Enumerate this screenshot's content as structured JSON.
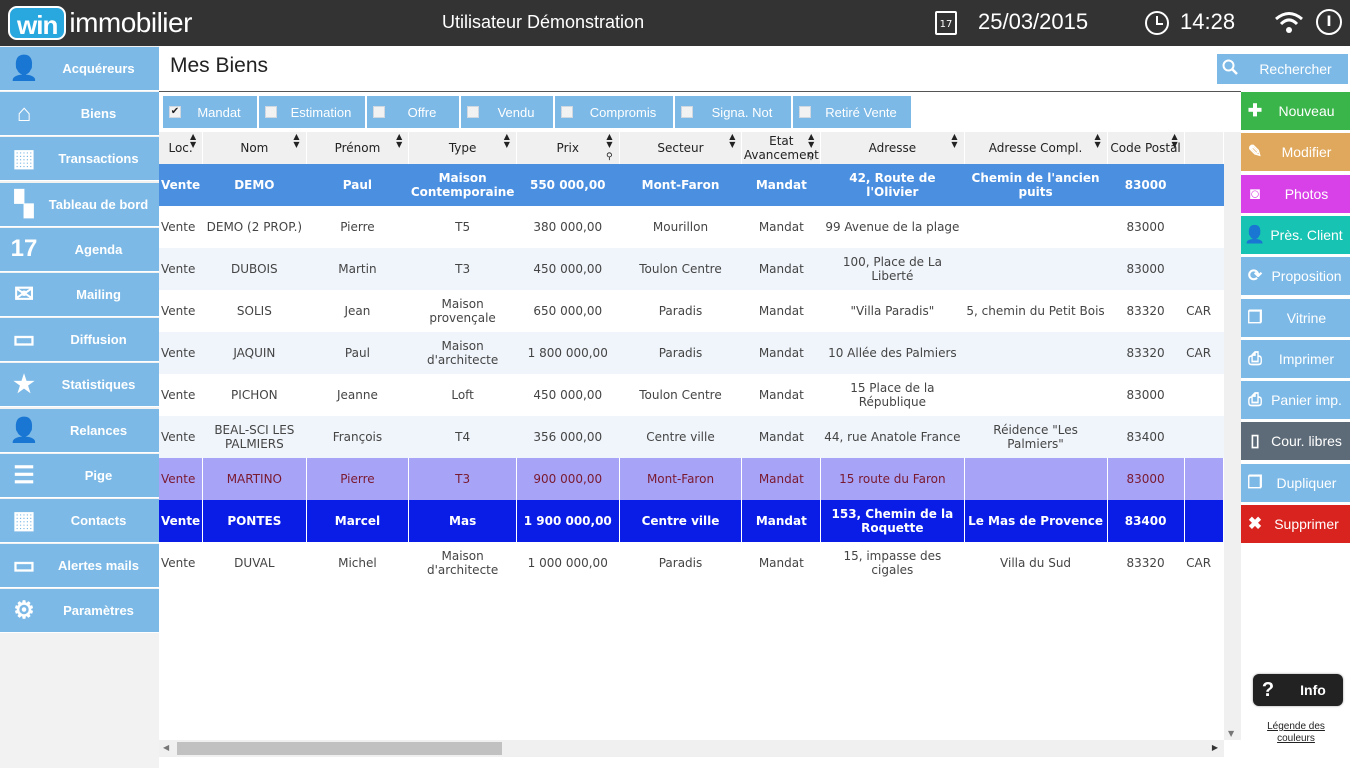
{
  "header": {
    "logo_win": "win",
    "logo_rest": "immobilier",
    "user": "Utilisateur Démonstration",
    "calendar_day": "17",
    "date": "25/03/2015",
    "time": "14:28",
    "power_glyph": "I"
  },
  "sidebar": {
    "items": [
      {
        "label": "Acquéreurs",
        "icon": "👤",
        "icon_name": "user-icon"
      },
      {
        "label": "Biens",
        "icon": "⌂",
        "icon_name": "house-icon"
      },
      {
        "label": "Transactions",
        "icon": "▦",
        "icon_name": "transactions-icon"
      },
      {
        "label": "Tableau de bord",
        "icon": "▚",
        "icon_name": "dashboard-icon"
      },
      {
        "label": "Agenda",
        "icon": "17",
        "icon_name": "calendar-icon"
      },
      {
        "label": "Mailing",
        "icon": "✉",
        "icon_name": "mail-icon"
      },
      {
        "label": "Diffusion",
        "icon": "▭",
        "icon_name": "diffusion-icon"
      },
      {
        "label": "Statistiques",
        "icon": "★",
        "icon_name": "star-icon"
      },
      {
        "label": "Relances",
        "icon": "👤",
        "icon_name": "relances-icon"
      },
      {
        "label": "Pige",
        "icon": "☰",
        "icon_name": "list-icon"
      },
      {
        "label": "Contacts",
        "icon": "▦",
        "icon_name": "contacts-icon"
      },
      {
        "label": "Alertes mails",
        "icon": "▭",
        "icon_name": "monitor-icon"
      },
      {
        "label": "Paramètres",
        "icon": "⚙",
        "icon_name": "gear-icon"
      }
    ]
  },
  "main": {
    "title": "Mes Biens",
    "search_label": "Rechercher"
  },
  "filters": [
    {
      "label": "Mandat",
      "checked": "✔"
    },
    {
      "label": "Estimation",
      "checked": ""
    },
    {
      "label": "Offre",
      "checked": ""
    },
    {
      "label": "Vendu",
      "checked": ""
    },
    {
      "label": "Compromis",
      "checked": ""
    },
    {
      "label": "Signa. Not",
      "checked": ""
    },
    {
      "label": "Retiré Vente",
      "checked": ""
    }
  ],
  "table": {
    "columns": [
      "Loc.",
      "Nom",
      "Prénom",
      "Type",
      "Prix",
      "Secteur",
      "Etat Avancement",
      "Adresse",
      "Adresse Compl.",
      "Code Postal",
      ""
    ],
    "rows": [
      [
        "Vente",
        "DEMO",
        "Paul",
        "Maison Contemporaine",
        "550 000,00",
        "Mont-Faron",
        "Mandat",
        "42, Route de l'Olivier",
        "Chemin de l'ancien puits",
        "83000",
        ""
      ],
      [
        "Vente",
        "DEMO (2 PROP.)",
        "Pierre",
        "T5",
        "380 000,00",
        "Mourillon",
        "Mandat",
        "99 Avenue de la plage",
        "",
        "83000",
        ""
      ],
      [
        "Vente",
        "DUBOIS",
        "Martin",
        "T3",
        "450 000,00",
        "Toulon Centre",
        "Mandat",
        "100, Place de La Liberté",
        "",
        "83000",
        ""
      ],
      [
        "Vente",
        "SOLIS",
        "Jean",
        "Maison provençale",
        "650 000,00",
        "Paradis",
        "Mandat",
        "\"Villa Paradis\"",
        "5, chemin du Petit Bois",
        "83320",
        "CAR"
      ],
      [
        "Vente",
        "JAQUIN",
        "Paul",
        "Maison d'architecte",
        "1 800 000,00",
        "Paradis",
        "Mandat",
        "10 Allée des Palmiers",
        "",
        "83320",
        "CAR"
      ],
      [
        "Vente",
        "PICHON",
        "Jeanne",
        "Loft",
        "450 000,00",
        "Toulon Centre",
        "Mandat",
        "15 Place de la République",
        "",
        "83000",
        ""
      ],
      [
        "Vente",
        "BEAL-SCI LES PALMIERS",
        "François",
        "T4",
        "356 000,00",
        "Centre ville",
        "Mandat",
        "44, rue Anatole France",
        "Réidence \"Les Palmiers\"",
        "83400",
        ""
      ],
      [
        "Vente",
        "MARTINO",
        "Pierre",
        "T3",
        "900 000,00",
        "Mont-Faron",
        "Mandat",
        "15 route du Faron",
        "",
        "83000",
        ""
      ],
      [
        "Vente",
        "PONTES",
        "Marcel",
        "Mas",
        "1 900 000,00",
        "Centre ville",
        "Mandat",
        "153, Chemin de la Roquette",
        "Le Mas de Provence",
        "83400",
        ""
      ],
      [
        "Vente",
        "DUVAL",
        "Michel",
        "Maison d'architecte",
        "1 000 000,00",
        "Paradis",
        "Mandat",
        "15, impasse des cigales",
        "Villa du Sud",
        "83320",
        "CAR"
      ]
    ]
  },
  "actions": [
    {
      "label": "Nouveau",
      "icon": "✚",
      "color": "#3ab54a",
      "icon_name": "plus-icon"
    },
    {
      "label": "Modifier",
      "icon": "✎",
      "color": "#e0a85c",
      "icon_name": "pencil-icon"
    },
    {
      "label": "Photos",
      "icon": "◙",
      "color": "#d840e8",
      "icon_name": "camera-icon"
    },
    {
      "label": "Près. Client",
      "icon": "👤",
      "color": "#17c3b2",
      "icon_name": "client-icon"
    },
    {
      "label": "Proposition",
      "icon": "⟳",
      "color": "#7cb9e6",
      "icon_name": "refresh-icon"
    },
    {
      "label": "Vitrine",
      "icon": "❐",
      "color": "#7cb9e6",
      "icon_name": "copy-icon"
    },
    {
      "label": "Imprimer",
      "icon": "⎙",
      "color": "#7cb9e6",
      "icon_name": "print-icon"
    },
    {
      "label": "Panier imp.",
      "icon": "⎙",
      "color": "#7cb9e6",
      "icon_name": "print-basket-icon"
    },
    {
      "label": "Cour. libres",
      "icon": "▯",
      "color": "#5d6b78",
      "icon_name": "document-icon"
    },
    {
      "label": "Dupliquer",
      "icon": "❐",
      "color": "#7cb9e6",
      "icon_name": "duplicate-icon"
    },
    {
      "label": "Supprimer",
      "icon": "✖",
      "color": "#d8231f",
      "icon_name": "delete-icon"
    }
  ],
  "info": {
    "label": "Info",
    "icon": "?"
  },
  "legend_link": "Légende des couleurs",
  "colors": {
    "accent": "#7cb9e6",
    "topbar": "#333333",
    "selected_row": "#4b8fe0",
    "purple_row": "#a7a3f7",
    "blue_row": "#0a1de6"
  }
}
